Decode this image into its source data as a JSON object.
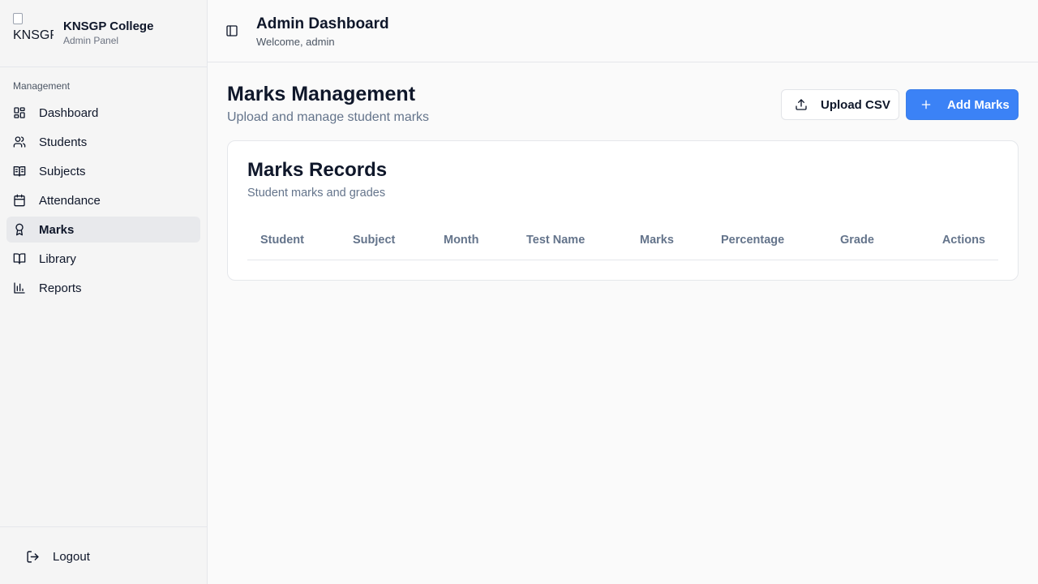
{
  "sidebar": {
    "logo_alt": "KNSGP College",
    "brand_title": "KNSGP College",
    "brand_subtitle": "Admin Panel",
    "group_label": "Management",
    "items": [
      {
        "label": "Dashboard",
        "icon": "dashboard-icon"
      },
      {
        "label": "Students",
        "icon": "users-icon"
      },
      {
        "label": "Subjects",
        "icon": "book-open-icon"
      },
      {
        "label": "Attendance",
        "icon": "calendar-icon"
      },
      {
        "label": "Marks",
        "icon": "award-icon",
        "active": true
      },
      {
        "label": "Library",
        "icon": "book-icon"
      },
      {
        "label": "Reports",
        "icon": "bar-chart-icon"
      }
    ],
    "logout_label": "Logout"
  },
  "header": {
    "title": "Admin Dashboard",
    "welcome": "Welcome, admin"
  },
  "main": {
    "title": "Marks Management",
    "subtitle": "Upload and manage student marks",
    "upload_label": "Upload CSV",
    "add_label": "Add Marks",
    "card": {
      "title": "Marks Records",
      "subtitle": "Student marks and grades",
      "columns": [
        "Student",
        "Subject",
        "Month",
        "Test Name",
        "Marks",
        "Percentage",
        "Grade",
        "Actions"
      ]
    }
  },
  "colors": {
    "primary": "#3b82f6",
    "sidebar_bg": "#f5f5f5",
    "active_item_bg": "#e8e9ec"
  }
}
